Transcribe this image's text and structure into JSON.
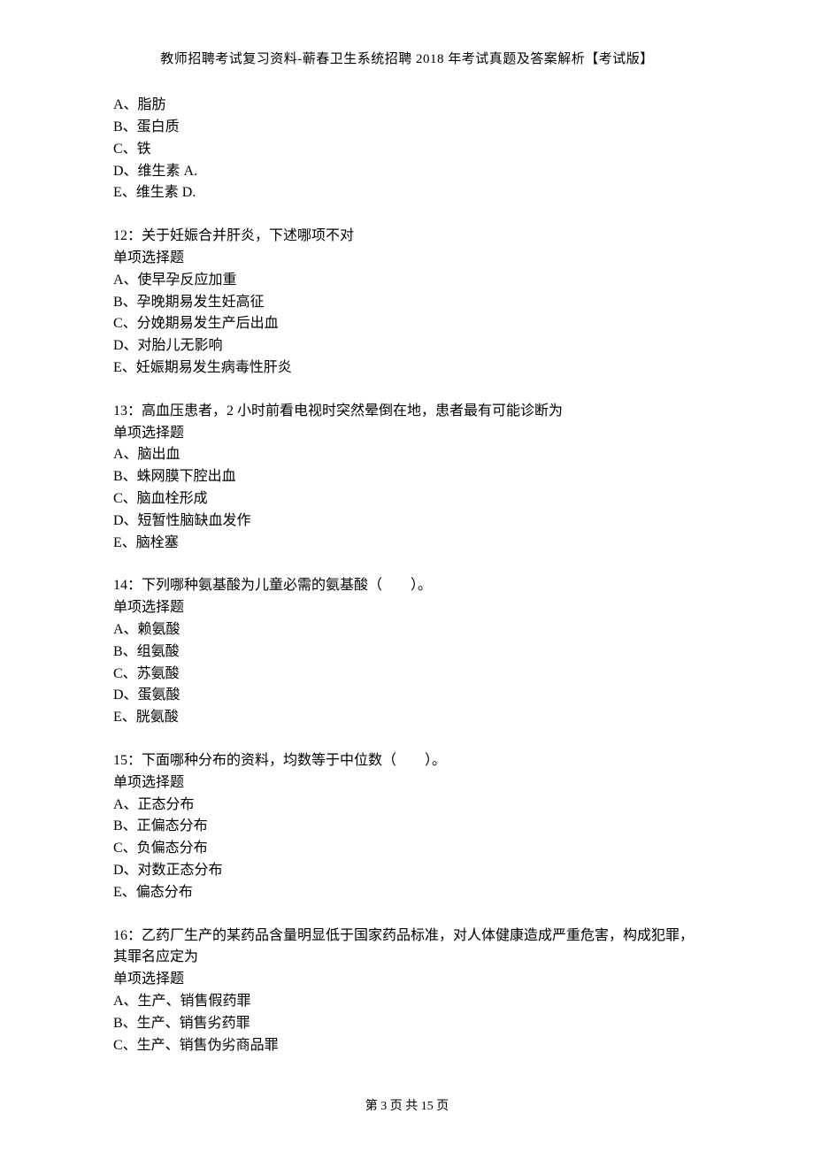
{
  "header": {
    "title": "教师招聘考试复习资料-蕲春卫生系统招聘 2018 年考试真题及答案解析【考试版】"
  },
  "q11_options": {
    "a": "A、脂肪",
    "b": "B、蛋白质",
    "c": "C、铁",
    "d": "D、维生素 A.",
    "e": "E、维生素 D."
  },
  "q12": {
    "stem": "12：关于妊娠合并肝炎，下述哪项不对",
    "type": "单项选择题",
    "a": "A、使早孕反应加重",
    "b": "B、孕晚期易发生妊高征",
    "c": "C、分娩期易发生产后出血",
    "d": "D、对胎儿无影响",
    "e": "E、妊娠期易发生病毒性肝炎"
  },
  "q13": {
    "stem": "13：高血压患者，2 小时前看电视时突然晕倒在地，患者最有可能诊断为",
    "type": "单项选择题",
    "a": "A、脑出血",
    "b": "B、蛛网膜下腔出血",
    "c": "C、脑血栓形成",
    "d": "D、短暂性脑缺血发作",
    "e": "E、脑栓塞"
  },
  "q14": {
    "stem": "14：下列哪种氨基酸为儿童必需的氨基酸（　　）。",
    "type": "单项选择题",
    "a": "A、赖氨酸",
    "b": "B、组氨酸",
    "c": "C、苏氨酸",
    "d": "D、蛋氨酸",
    "e": "E、胱氨酸"
  },
  "q15": {
    "stem": "15：下面哪种分布的资料，均数等于中位数（　　）。",
    "type": "单项选择题",
    "a": "A、正态分布",
    "b": "B、正偏态分布",
    "c": "C、负偏态分布",
    "d": "D、对数正态分布",
    "e": "E、偏态分布"
  },
  "q16": {
    "stem": "16：乙药厂生产的某药品含量明显低于国家药品标准，对人体健康造成严重危害，构成犯罪，其罪名应定为",
    "type": "单项选择题",
    "a": "A、生产、销售假药罪",
    "b": "B、生产、销售劣药罪",
    "c": "C、生产、销售伪劣商品罪"
  },
  "footer": {
    "text": "第 3 页 共 15 页"
  }
}
